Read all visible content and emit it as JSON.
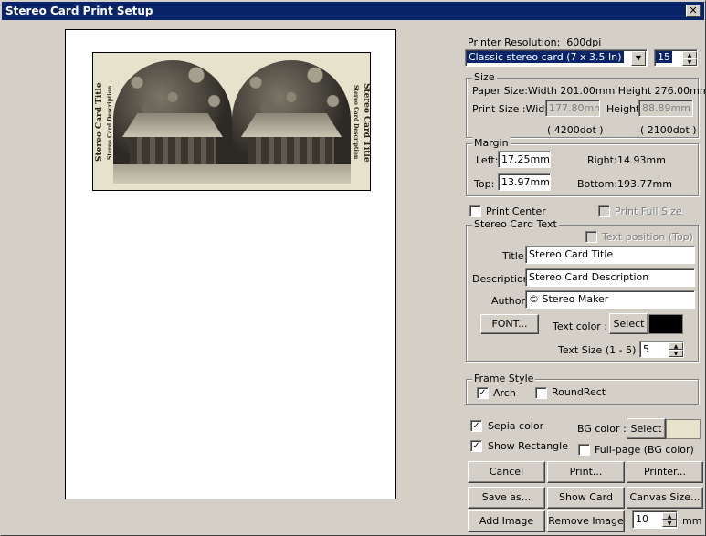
{
  "window": {
    "title": "Stereo Card Print Setup",
    "close_glyph": "✕"
  },
  "preview": {
    "card_title": "Stereo Card Title",
    "card_description": "Stereo Card Description"
  },
  "printer": {
    "resolution_label": "Printer Resolution:",
    "resolution_value": "600dpi",
    "format_selected": "Classic stereo card (7 x 3.5 In)",
    "count_value": "15"
  },
  "size": {
    "group_title": "Size",
    "paper_size_text": "Paper Size:Width 201.00mm Height 276.00mm",
    "print_size_label": "Print Size :Width",
    "print_width": "177.80mm",
    "height_label": "Height",
    "print_height": "88.89mm",
    "width_dots": "( 4200dot )",
    "height_dots": "( 2100dot )"
  },
  "margin": {
    "group_title": "Margin",
    "left_label": "Left:",
    "left_value": "17.25mm",
    "top_label": "Top:",
    "top_value": "13.97mm",
    "right_label": "Right:",
    "right_value": "14.93mm",
    "bottom_label": "Bottom:",
    "bottom_value": "193.77mm"
  },
  "options": {
    "print_center": "Print Center",
    "print_full_size": "Print Full Size"
  },
  "stereo_text": {
    "group_title": "Stereo Card Text",
    "text_position": "Text position (Top)",
    "title_label": "Title:",
    "title_value": "Stereo Card Title",
    "description_label": "Description:",
    "description_value": "Stereo Card Description",
    "author_label": "Author:",
    "author_value": "© Stereo Maker",
    "font_button": "FONT...",
    "text_color_label": "Text color :",
    "select_button": "Select",
    "text_color": "#000000",
    "text_size_label": "Text Size (1 - 5) :",
    "text_size_value": "5"
  },
  "frame_style": {
    "group_title": "Frame Style",
    "arch": "Arch",
    "arch_checked": true,
    "roundrect": "RoundRect",
    "roundrect_checked": false
  },
  "appearance": {
    "sepia": "Sepia color",
    "sepia_checked": true,
    "show_rectangle": "Show Rectangle",
    "show_rectangle_checked": true,
    "bg_color_label": "BG color :",
    "bg_select_button": "Select",
    "bg_color": "#e6e2cc",
    "full_page": "Full-page (BG color)",
    "full_page_checked": false
  },
  "buttons": {
    "cancel": "Cancel",
    "print": "Print...",
    "printer": "Printer...",
    "save_as": "Save as...",
    "show_card": "Show Card",
    "canvas_size": "Canvas Size...",
    "add_image": "Add Image",
    "remove_image": "Remove Image",
    "spacing_value": "10",
    "spacing_unit": "mm"
  }
}
